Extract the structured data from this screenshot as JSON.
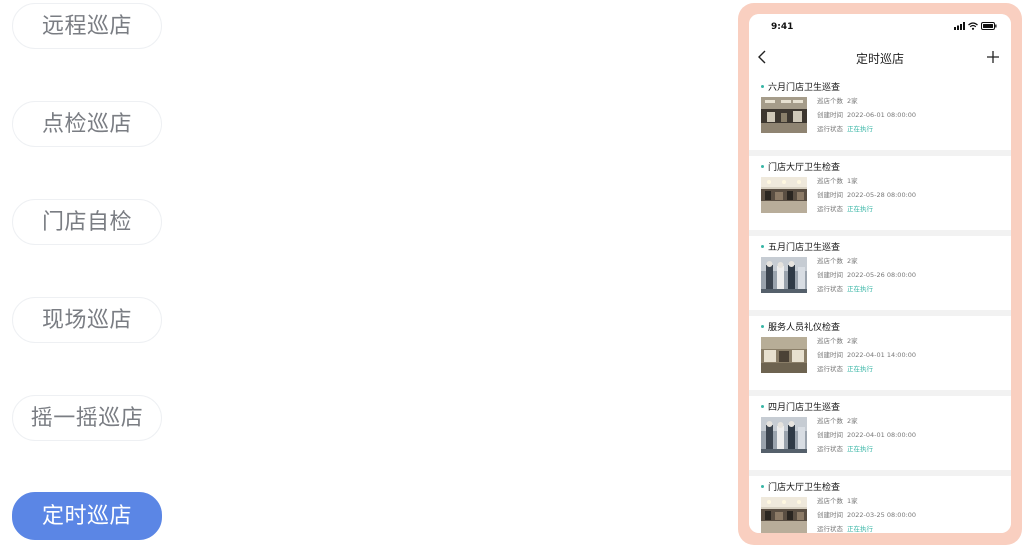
{
  "menu": {
    "items": [
      {
        "label": "远程巡店",
        "active": false
      },
      {
        "label": "点检巡店",
        "active": false
      },
      {
        "label": "门店自检",
        "active": false
      },
      {
        "label": "现场巡店",
        "active": false
      },
      {
        "label": "摇一摇巡店",
        "active": false
      },
      {
        "label": "定时巡店",
        "active": true
      }
    ]
  },
  "phone": {
    "status_time": "9:41",
    "nav_title": "定时巡店",
    "labels": {
      "store_count": "巡店个数",
      "created": "创建时间",
      "status": "运行状态"
    },
    "cards": [
      {
        "title": "六月门店卫生巡查",
        "store_count": "2家",
        "created": "2022-06-01 08:00:00",
        "status": "正在执行",
        "thumb": "room-dark"
      },
      {
        "title": "门店大厅卫生检查",
        "store_count": "1家",
        "created": "2022-05-28 08:00:00",
        "status": "正在执行",
        "thumb": "room-light"
      },
      {
        "title": "五月门店卫生巡查",
        "store_count": "2家",
        "created": "2022-05-26 08:00:00",
        "status": "正在执行",
        "thumb": "mannequins"
      },
      {
        "title": "服务人员礼仪检查",
        "store_count": "2家",
        "created": "2022-04-01 14:00:00",
        "status": "正在执行",
        "thumb": "room-dark"
      },
      {
        "title": "四月门店卫生巡查",
        "store_count": "2家",
        "created": "2022-04-01 08:00:00",
        "status": "正在执行",
        "thumb": "mannequins"
      },
      {
        "title": "门店大厅卫生检查",
        "store_count": "1家",
        "created": "2022-03-25 08:00:00",
        "status": "正在执行",
        "thumb": "room-light"
      }
    ]
  },
  "colors": {
    "accent": "#5b86e5",
    "phone_frame": "#f9cfc0",
    "status_green": "#38b6a6"
  }
}
